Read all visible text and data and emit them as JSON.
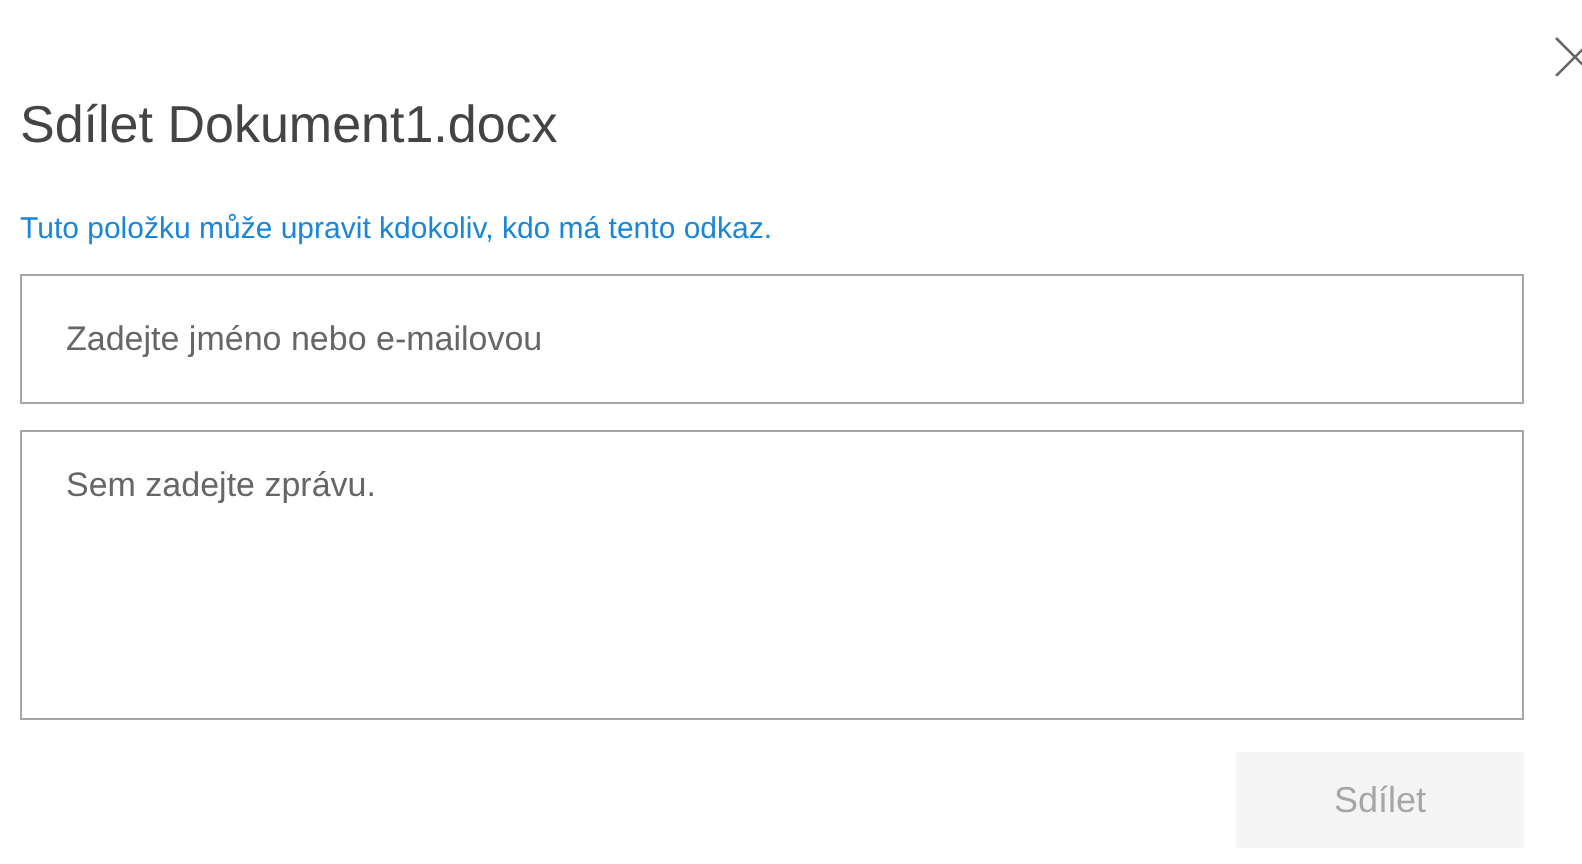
{
  "dialog": {
    "title": "Sdílet Dokument1.docx",
    "link_notice": "Tuto položku může upravit kdokoliv, kdo má tento odkaz.",
    "recipient_field": {
      "placeholder": "Zadejte jméno nebo e-mailovou"
    },
    "message_field": {
      "placeholder": "Sem zadejte zprávu."
    },
    "share_button": {
      "label": "Sdílet",
      "disabled": true
    }
  }
}
